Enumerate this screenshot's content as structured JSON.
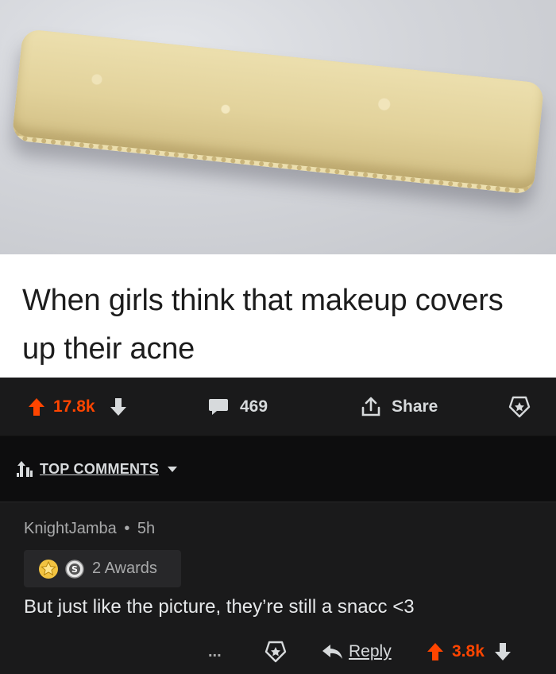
{
  "post": {
    "caption": "When girls think that makeup covers up their acne"
  },
  "actions": {
    "upvotes": "17.8k",
    "comments": "469",
    "share_label": "Share"
  },
  "sort": {
    "label": "TOP COMMENTS"
  },
  "comment": {
    "author": "KnightJamba",
    "separator": "•",
    "age": "5h",
    "awards_label": "2 Awards",
    "body": "But just like the picture, they’re still a snacc <3",
    "ellipsis": "...",
    "reply_label": "Reply",
    "score": "3.8k"
  },
  "colors": {
    "upvote": "#ff4500",
    "dark_bg": "#1a1a1b",
    "darker_bg": "#0d0d0e",
    "text": "#d7dadc"
  },
  "icons": [
    "upvote-icon",
    "downvote-icon",
    "comment-icon",
    "share-icon",
    "award-icon",
    "sort-icon",
    "dropdown-icon",
    "gold-award-icon",
    "silver-award-icon",
    "more-icon",
    "reply-icon"
  ]
}
